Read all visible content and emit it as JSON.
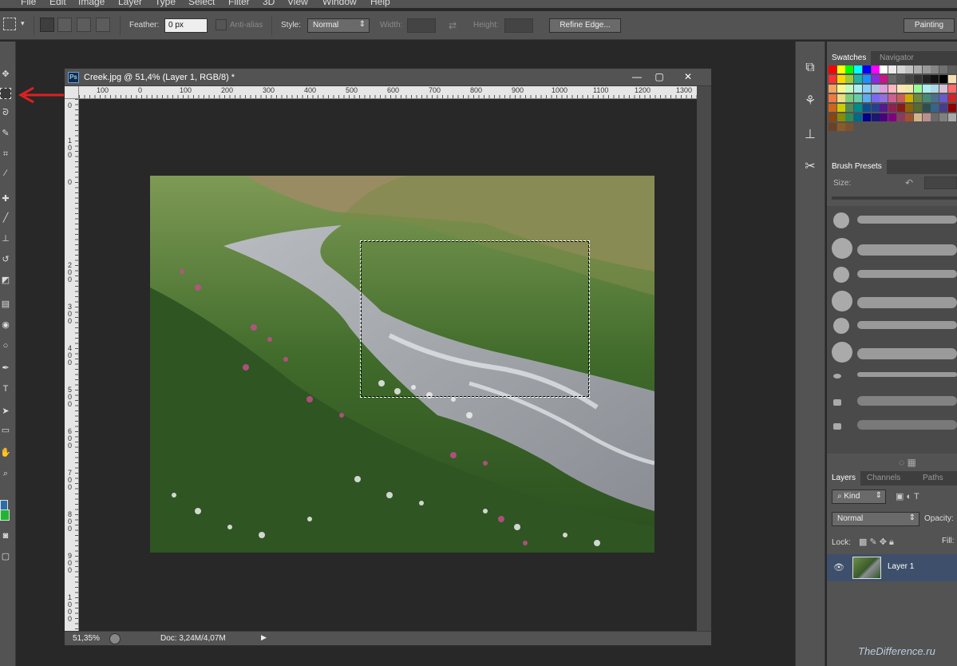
{
  "menu": [
    "File",
    "Edit",
    "Image",
    "Layer",
    "Type",
    "Select",
    "Filter",
    "3D",
    "View",
    "Window",
    "Help"
  ],
  "options": {
    "feather_label": "Feather:",
    "feather_value": "0 px",
    "antialias_label": "Anti-alias",
    "style_label": "Style:",
    "style_value": "Normal",
    "width_label": "Width:",
    "height_label": "Height:",
    "refine_edge": "Refine Edge...",
    "workspace": "Painting"
  },
  "document": {
    "title": "Creek.jpg @ 51,4% (Layer 1, RGB/8) *",
    "ps_icon": "Ps",
    "ruler_h": [
      "100",
      "0",
      "100",
      "200",
      "300",
      "400",
      "500",
      "600",
      "700",
      "800",
      "900",
      "1000",
      "1100",
      "1200",
      "1300"
    ],
    "ruler_v": [
      "0",
      "100",
      "0",
      "200",
      "300",
      "400",
      "500",
      "600",
      "700",
      "800",
      "900",
      "1000"
    ],
    "zoom": "51,35%",
    "doc_size": "Doc: 3,24M/4,07M"
  },
  "panels": {
    "swatches_tab": "Swatches",
    "navigator_tab": "Navigator",
    "brush_presets_tab": "Brush Presets",
    "size_label": "Size:",
    "layers_tab": "Layers",
    "channels_tab": "Channels",
    "paths_tab": "Paths",
    "kind_value": "Kind",
    "blend_value": "Normal",
    "opacity_label": "Opacity:",
    "lock_label": "Lock:",
    "fill_label": "Fill:",
    "layer_name": "Layer 1"
  },
  "colors": {
    "foreground": "#2a6ea8",
    "background": "#22b531",
    "arrow": "#e02020",
    "selected_layer": "#3d4f6a"
  },
  "swatch_rows": [
    [
      "#ff0000",
      "#ffff00",
      "#00ff00",
      "#00ffff",
      "#0000ff",
      "#ff00ff",
      "#ffffff",
      "#ebebeb",
      "#d6d6d6",
      "#c2c2c2",
      "#adadad",
      "#999999",
      "#858585",
      "#707070",
      "#5c5c5c"
    ],
    [
      "#ff3030",
      "#ffd700",
      "#9acd32",
      "#20b2aa",
      "#1e90ff",
      "#8a2be2",
      "#c71585",
      "#666666",
      "#555555",
      "#444444",
      "#333333",
      "#222222",
      "#111111",
      "#000000",
      "#f5deb3"
    ],
    [
      "#f4a460",
      "#fff68f",
      "#c1ffc1",
      "#aeeeee",
      "#87cefa",
      "#b0c4de",
      "#dda0dd",
      "#ffb6c1",
      "#ffe4b5",
      "#eee8aa",
      "#98fb98",
      "#afeeee",
      "#add8e6",
      "#d8bfd8",
      "#ff6a6a"
    ],
    [
      "#ee7942",
      "#eedc82",
      "#7ccd7c",
      "#66cdaa",
      "#5cacee",
      "#7b68ee",
      "#9370db",
      "#cd6090",
      "#cd5c5c",
      "#cdad00",
      "#6e8b3d",
      "#458b74",
      "#4a708b",
      "#6959cd",
      "#cd2626"
    ],
    [
      "#cd661d",
      "#cdcd00",
      "#548b54",
      "#008b8b",
      "#104e8b",
      "#27408b",
      "#551a8b",
      "#8b2252",
      "#8b1a1a",
      "#8b6508",
      "#556b2f",
      "#2f4f4f",
      "#36648b",
      "#483d8b",
      "#8b0000"
    ],
    [
      "#8b4513",
      "#8b8b00",
      "#2e8b57",
      "#00688b",
      "#00008b",
      "#191970",
      "#4b0082",
      "#800080",
      "#8b3a62",
      "#a0522d",
      "#d2b48c",
      "#bc8f8f",
      "#696969",
      "#808080",
      "#a9a9a9"
    ],
    [
      "#6b4226",
      "#8b5a2b",
      "#7a5230"
    ]
  ],
  "tool_icons": [
    "move-icon",
    "marquee-icon",
    "lasso-icon",
    "quick-select-icon",
    "crop-icon",
    "eyedropper-icon",
    "healing-icon",
    "brush-icon",
    "stamp-icon",
    "history-brush-icon",
    "eraser-icon",
    "gradient-icon",
    "blur-icon",
    "dodge-icon",
    "pen-icon",
    "type-icon",
    "path-select-icon",
    "shape-icon",
    "hand-icon",
    "zoom-icon"
  ]
}
